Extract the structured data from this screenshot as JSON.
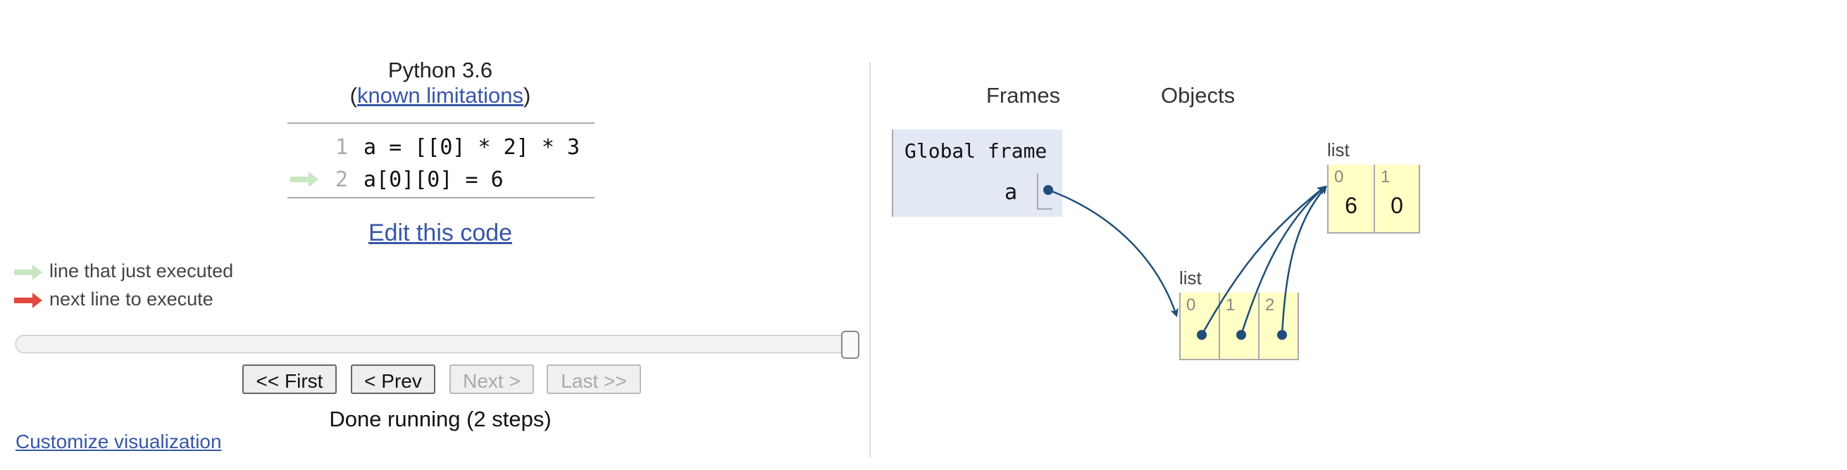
{
  "header": {
    "title": "Python 3.6",
    "open_paren": "(",
    "limitations_link": "known limitations",
    "close_paren": ")"
  },
  "code": {
    "lines": [
      {
        "number": "1",
        "text": "a = [[0] * 2] * 3"
      },
      {
        "number": "2",
        "text": "a[0][0] = 6"
      }
    ]
  },
  "edit_link": "Edit this code",
  "legend": {
    "executed": "line that just executed",
    "next": "next line to execute",
    "executed_color": "#c8e6c0",
    "next_color": "#e0493c"
  },
  "slider": {
    "value": "2",
    "max": "2"
  },
  "controls": {
    "first": "<< First",
    "prev": "< Prev",
    "next": "Next >",
    "last": "Last >>"
  },
  "status": "Done running (2 steps)",
  "customize_link": "Customize visualization",
  "viz": {
    "frames_heading": "Frames",
    "objects_heading": "Objects",
    "global_frame": {
      "title": "Global frame",
      "variable": "a"
    },
    "outer_list": {
      "label": "list",
      "indices": [
        "0",
        "1",
        "2"
      ]
    },
    "inner_list": {
      "label": "list",
      "indices": [
        "0",
        "1"
      ],
      "values": [
        "6",
        "0"
      ]
    },
    "colors": {
      "frame_bg": "#e2e8f4",
      "heap_bg": "#ffffc6",
      "pointer": "#1f4e79",
      "link": "#3856a8"
    }
  }
}
